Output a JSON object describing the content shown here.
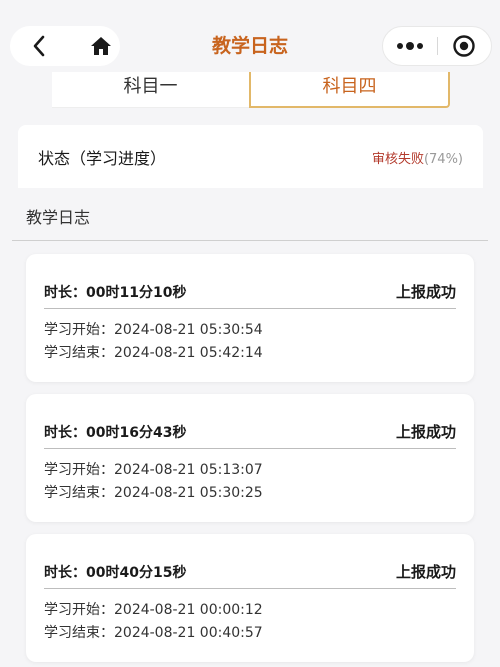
{
  "nav": {
    "title": "教学日志",
    "back_icon": "chevron-left-icon",
    "home_icon": "home-icon",
    "more_icon": "more-dots-icon",
    "close_icon": "target-close-icon",
    "title_color": "#c8641e"
  },
  "tabs": [
    {
      "label": "科目一",
      "active": false
    },
    {
      "label": "科目四",
      "active": true
    }
  ],
  "status": {
    "label": "状态（学习进度）",
    "result": "审核失败",
    "progress": "(74%)",
    "result_color": "#b33a2c"
  },
  "section": {
    "title": "教学日志"
  },
  "logs": [
    {
      "duration_prefix": "时长：",
      "duration": "00时11分10秒",
      "report_status": "上报成功",
      "start_label": "学习开始：",
      "start": "2024-08-21 05:30:54",
      "end_label": "学习结束：",
      "end": "2024-08-21 05:42:14"
    },
    {
      "duration_prefix": "时长：",
      "duration": "00时16分43秒",
      "report_status": "上报成功",
      "start_label": "学习开始：",
      "start": "2024-08-21 05:13:07",
      "end_label": "学习结束：",
      "end": "2024-08-21 05:30:25"
    },
    {
      "duration_prefix": "时长：",
      "duration": "00时40分15秒",
      "report_status": "上报成功",
      "start_label": "学习开始：",
      "start": "2024-08-21 00:00:12",
      "end_label": "学习结束：",
      "end": "2024-08-21 00:40:57"
    }
  ]
}
